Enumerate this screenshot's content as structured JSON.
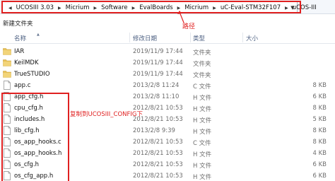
{
  "address_bar": {
    "crumbs": [
      "UCOSIII 3.03",
      "Micrium",
      "Software",
      "EvalBoards",
      "Micrium",
      "uC-Eval-STM32F107",
      "uCOS-III"
    ],
    "annotation": "路径"
  },
  "toolbar": {
    "new_folder": "新建文件夹"
  },
  "columns": {
    "name": "名称",
    "date": "修改日期",
    "type": "类型",
    "size": "大小"
  },
  "files": [
    {
      "name": "IAR",
      "date": "2019/11/9 17:44",
      "type": "文件夹",
      "size": "",
      "icon": "folder-icon"
    },
    {
      "name": "KeilMDK",
      "date": "2019/11/9 17:44",
      "type": "文件夹",
      "size": "",
      "icon": "folder-icon"
    },
    {
      "name": "TrueSTUDIO",
      "date": "2019/11/9 17:44",
      "type": "文件夹",
      "size": "",
      "icon": "folder-icon"
    },
    {
      "name": "app.c",
      "date": "2013/2/8 11:24",
      "type": "C 文件",
      "size": "8 KB",
      "icon": "file-icon"
    },
    {
      "name": "app_cfg.h",
      "date": "2013/2/8 11:10",
      "type": "H 文件",
      "size": "6 KB",
      "icon": "file-icon"
    },
    {
      "name": "cpu_cfg.h",
      "date": "2012/8/21 10:53",
      "type": "H 文件",
      "size": "8 KB",
      "icon": "file-icon"
    },
    {
      "name": "includes.h",
      "date": "2012/8/21 10:53",
      "type": "H 文件",
      "size": "5 KB",
      "icon": "file-icon"
    },
    {
      "name": "lib_cfg.h",
      "date": "2013/2/8 9:39",
      "type": "H 文件",
      "size": "8 KB",
      "icon": "file-icon"
    },
    {
      "name": "os_app_hooks.c",
      "date": "2012/8/21 10:53",
      "type": "C 文件",
      "size": "8 KB",
      "icon": "file-icon"
    },
    {
      "name": "os_app_hooks.h",
      "date": "2012/8/21 10:53",
      "type": "H 文件",
      "size": "4 KB",
      "icon": "file-icon"
    },
    {
      "name": "os_cfg.h",
      "date": "2012/8/21 10:53",
      "type": "H 文件",
      "size": "6 KB",
      "icon": "file-icon"
    },
    {
      "name": "os_cfg_app.h",
      "date": "2012/8/21 10:53",
      "type": "H 文件",
      "size": "6 KB",
      "icon": "file-icon"
    }
  ],
  "annotation_config": "复制到UCOSIII_CONFIG下",
  "colors": {
    "annotation_red": "#e02020",
    "header_text": "#4d6082",
    "folder": "#e8c158"
  }
}
